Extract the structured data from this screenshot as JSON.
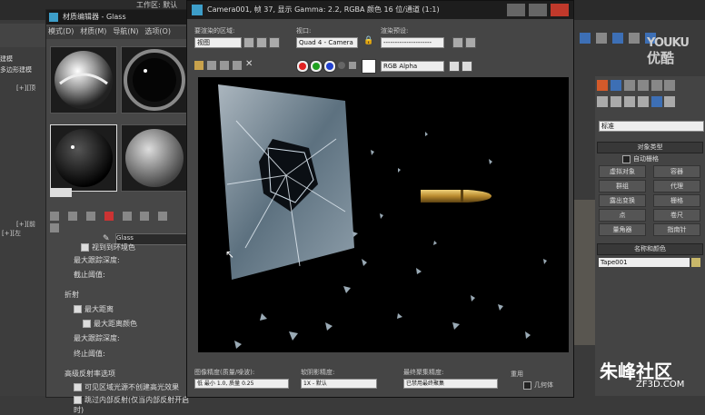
{
  "max": {
    "title_fragment": "工作区: 默认",
    "left_panel": {
      "label1": "建模",
      "label2": "多边形建模",
      "vp_label": "[+][顶",
      "vp_label2": "[+][前",
      "vp_label3": "[+][左"
    },
    "right_panel": {
      "dropdown": "标准",
      "section1": "对象类型",
      "autogrid": "自动栅格",
      "buttons": [
        "虚拟对象",
        "容器",
        "群组",
        "代理",
        "露出变换",
        "栅格",
        "点",
        "卷尺",
        "量角器",
        "指南针"
      ],
      "section2": "名称和颜色",
      "name_value": "Tape001"
    }
  },
  "material_editor": {
    "title": "材质编辑器 - Glass",
    "menu": [
      "模式(D)",
      "材质(M)",
      "导航(N)",
      "选项(O)"
    ],
    "material_name": "Glass",
    "params": {
      "reflect_exit": "视到到环境色",
      "max_depth1": "最大跟踪深度:",
      "cutoff1": "截止阈值:",
      "refraction_header": "折射",
      "max_distance": "最大距离",
      "max_distance_color": "最大距离颜色",
      "max_depth2": "最大跟踪深度:",
      "cutoff2": "终止阈值:",
      "advanced_header": "高级反射率选项",
      "adv1": "可见区域光源不创建高光效果",
      "adv2": "跳过内部反射(仅当内部反射开启时)"
    }
  },
  "render_frame": {
    "title": "Camera001, 帧 37, 显示 Gamma: 2.2, RGBA 颜色 16 位/通道 (1:1)",
    "area_label": "要渲染的区域:",
    "area_value": "视图",
    "viewport_label": "视口:",
    "viewport_value": "Quad 4 - Camera",
    "preset_label": "渲染预设:",
    "preset_value": "---------------------",
    "channel_value": "RGB Alpha",
    "bottom": {
      "quality_label": "图像精度(质量/噪波):",
      "quality_value": "低 最小 1.0, 质量 0.25",
      "soft_label": "软阴影精度:",
      "soft_value": "1X - 默认",
      "final_gather_label": "最终聚集精度:",
      "final_gather_value": "已禁用最终聚集",
      "reuse_label": "重用",
      "reuse_item": "几何体"
    }
  },
  "watermarks": {
    "youku": "YOUKU",
    "youku_cn": "优酷",
    "zf": "朱峰社区",
    "zf_url": "ZF3D.COM"
  },
  "colors": {
    "render_bg": "#000000",
    "bullet": "#c9a24c",
    "glass": "#8aa2b5",
    "ui_dark": "#1d1d1d",
    "ui_mid": "#454545"
  }
}
